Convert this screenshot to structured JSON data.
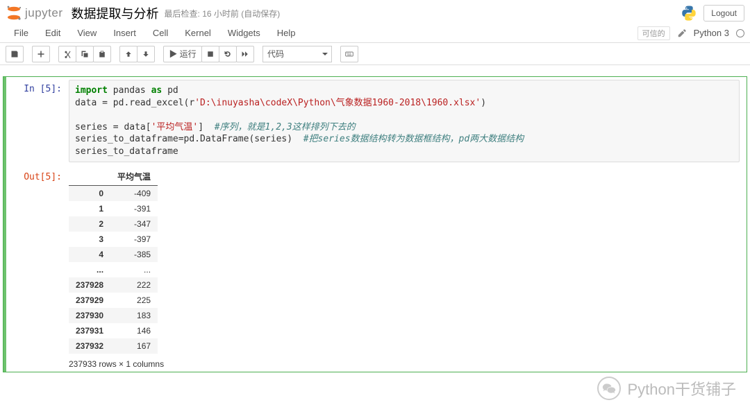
{
  "header": {
    "logo_text": "jupyter",
    "notebook_name": "数据提取与分析",
    "save_status": "最后检查: 16 小时前 (自动保存)",
    "logout": "Logout"
  },
  "menubar": {
    "items": [
      "File",
      "Edit",
      "View",
      "Insert",
      "Cell",
      "Kernel",
      "Widgets",
      "Help"
    ],
    "trusted": "可信的",
    "kernel_name": "Python 3"
  },
  "toolbar": {
    "run_label": "▶ 运行",
    "celltype_selected": "代码"
  },
  "cell": {
    "in_prompt": "In [5]:",
    "out_prompt": "Out[5]:",
    "code": {
      "line1_a": "import",
      "line1_b": " pandas ",
      "line1_c": "as",
      "line1_d": " pd",
      "line2_a": "data = pd.read_excel(r",
      "line2_str": "'D:\\inuyasha\\codeX\\Python\\气象数据1960-2018\\1960.xlsx'",
      "line2_b": ")",
      "line3": "",
      "line4_a": "series = data[",
      "line4_str": "'平均气温'",
      "line4_b": "]  ",
      "line4_cm": "#序列，就是1,2,3这样排列下去的",
      "line5_a": "series_to_dataframe=pd.DataFrame(series)  ",
      "line5_cm": "#把series数据结构转为数据框结构，pd两大数据结构",
      "line6": "series_to_dataframe"
    },
    "output_table": {
      "column": "平均气温",
      "rows": [
        {
          "idx": "0",
          "val": "-409"
        },
        {
          "idx": "1",
          "val": "-391"
        },
        {
          "idx": "2",
          "val": "-347"
        },
        {
          "idx": "3",
          "val": "-397"
        },
        {
          "idx": "4",
          "val": "-385"
        },
        {
          "idx": "...",
          "val": "..."
        },
        {
          "idx": "237928",
          "val": "222"
        },
        {
          "idx": "237929",
          "val": "225"
        },
        {
          "idx": "237930",
          "val": "183"
        },
        {
          "idx": "237931",
          "val": "146"
        },
        {
          "idx": "237932",
          "val": "167"
        }
      ],
      "shape_text": "237933 rows × 1 columns"
    }
  },
  "watermark": "Python干货铺子"
}
